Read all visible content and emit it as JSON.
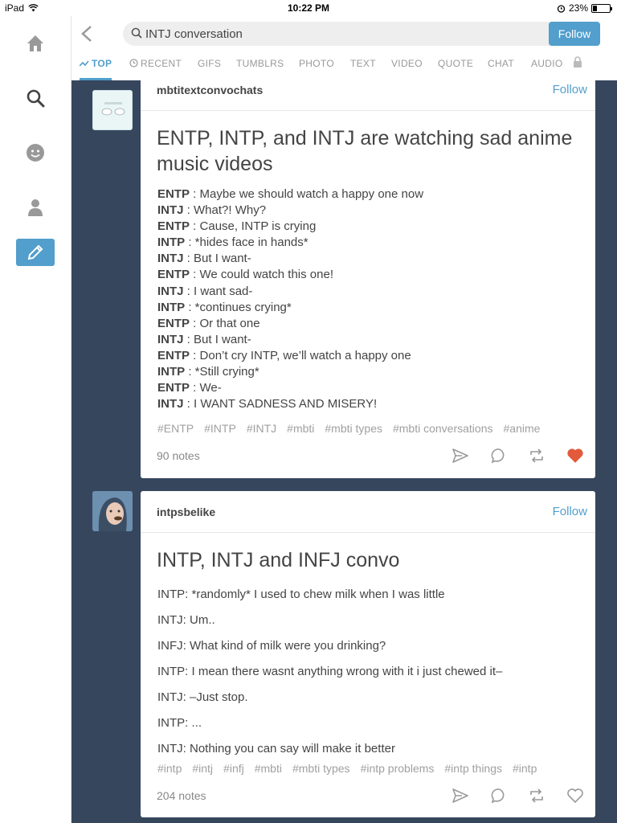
{
  "status_bar": {
    "device": "iPad",
    "time": "10:22 PM",
    "battery": "23%",
    "battery_fraction": 0.23
  },
  "search": {
    "query": "INTJ conversation",
    "follow_label": "Follow"
  },
  "tabs": [
    {
      "label": "TOP"
    },
    {
      "label": "RECENT"
    },
    {
      "label": "GIFS"
    },
    {
      "label": "TUMBLRS"
    },
    {
      "label": "PHOTO"
    },
    {
      "label": "TEXT"
    },
    {
      "label": "VIDEO"
    },
    {
      "label": "QUOTE"
    },
    {
      "label": "CHAT"
    },
    {
      "label": "AUDIO"
    }
  ],
  "sidebar": {
    "icons": [
      "home-icon",
      "search-icon",
      "activity-icon",
      "account-icon",
      "compose-icon"
    ]
  },
  "post1": {
    "blog": "mbtitextconvochats",
    "follow": "Follow",
    "title": "ENTP, INTP, and INTJ are watching sad anime music videos",
    "lines": [
      {
        "speaker": "ENTP",
        "text": " : Maybe we should watch a happy one now"
      },
      {
        "speaker": "INTJ",
        "text": " : What?! Why?"
      },
      {
        "speaker": "ENTP",
        "text": " : Cause, INTP is crying"
      },
      {
        "speaker": "INTP",
        "text": " : *hides face in hands*"
      },
      {
        "speaker": "INTJ",
        "text": " : But I want-"
      },
      {
        "speaker": "ENTP",
        "text": " : We could watch this one!"
      },
      {
        "speaker": "INTJ",
        "text": " : I want sad-"
      },
      {
        "speaker": "INTP",
        "text": " : *continues crying*"
      },
      {
        "speaker": "ENTP",
        "text": " : Or that one"
      },
      {
        "speaker": "INTJ",
        "text": " : But I want-"
      },
      {
        "speaker": "ENTP",
        "text": " : Don’t cry INTP, we’ll watch a happy one"
      },
      {
        "speaker": "INTP",
        "text": " : *Still crying*"
      },
      {
        "speaker": "ENTP",
        "text": " : We-"
      },
      {
        "speaker": "INTJ",
        "text": " : I WANT SADNESS AND MISERY!"
      }
    ],
    "tags": [
      "#ENTP",
      "#INTP",
      "#INTJ",
      "#mbti",
      "#mbti types",
      "#mbti conversations",
      "#anime"
    ],
    "notes": "90 notes",
    "liked": true,
    "like_color": "#e25a3b"
  },
  "post2": {
    "blog": "intpsbelike",
    "follow": "Follow",
    "title": "INTP, INTJ and INFJ convo",
    "lines": [
      "INTP: *randomly* I used to chew milk when I was little",
      "INTJ: Um..",
      "INFJ: What kind of milk were you drinking?",
      "INTP: I mean there wasnt anything wrong with it i just chewed it–",
      "INTJ: –Just stop.",
      "INTP: ...",
      "INTJ: Nothing you can say will make it better"
    ],
    "tags": [
      "#intp",
      "#intj",
      "#infj",
      "#mbti",
      "#mbti types",
      "#intp problems",
      "#intp things",
      "#intp"
    ],
    "notes": "204 notes",
    "liked": false
  },
  "colors": {
    "accent": "#529ecc",
    "dashboard_bg": "#36465d"
  }
}
